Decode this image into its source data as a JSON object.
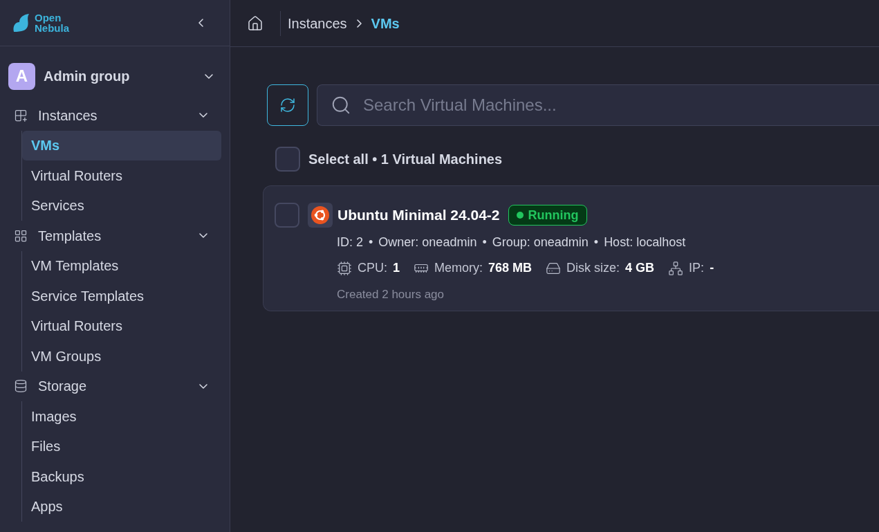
{
  "logo": {
    "line_1": "Open",
    "line_2": "Nebula"
  },
  "sidebar": {
    "group": {
      "initial": "A",
      "name": "Admin group",
      "expanded": false
    },
    "sections": [
      {
        "label": "Instances",
        "expanded": true,
        "children": [
          {
            "label": "VMs",
            "selected": true
          },
          {
            "label": "Virtual Routers",
            "selected": false
          },
          {
            "label": "Services",
            "selected": false
          }
        ]
      },
      {
        "label": "Templates",
        "expanded": true,
        "children": [
          {
            "label": "VM Templates",
            "selected": false
          },
          {
            "label": "Service Templates",
            "selected": false
          },
          {
            "label": "Virtual Routers",
            "selected": false
          },
          {
            "label": "VM Groups",
            "selected": false
          }
        ]
      },
      {
        "label": "Storage",
        "expanded": true,
        "children": [
          {
            "label": "Images",
            "selected": false
          },
          {
            "label": "Files",
            "selected": false
          },
          {
            "label": "Backups",
            "selected": false
          },
          {
            "label": "Apps",
            "selected": false
          }
        ]
      }
    ]
  },
  "breadcrumb": [
    "Instances",
    "VMs"
  ],
  "search": {
    "placeholder": "Search Virtual Machines..."
  },
  "select_all": {
    "checked": false,
    "label": "Select all • 1 Virtual Machines"
  },
  "vms": [
    {
      "checked": false,
      "name": "Ubuntu Minimal 24.04-2",
      "status": {
        "label": "Running",
        "color": "#22c55e"
      },
      "meta": [
        "ID: 2",
        "Owner: oneadmin",
        "Group: oneadmin",
        "Host: localhost"
      ],
      "meta_separator": "•",
      "stats": [
        {
          "label": "CPU:",
          "value": "1"
        },
        {
          "label": "Memory:",
          "value": "768 MB"
        },
        {
          "label": "Disk size:",
          "value": "4 GB"
        },
        {
          "label": "IP:",
          "value": "-"
        }
      ],
      "created": "Created 2 hours ago"
    }
  ]
}
